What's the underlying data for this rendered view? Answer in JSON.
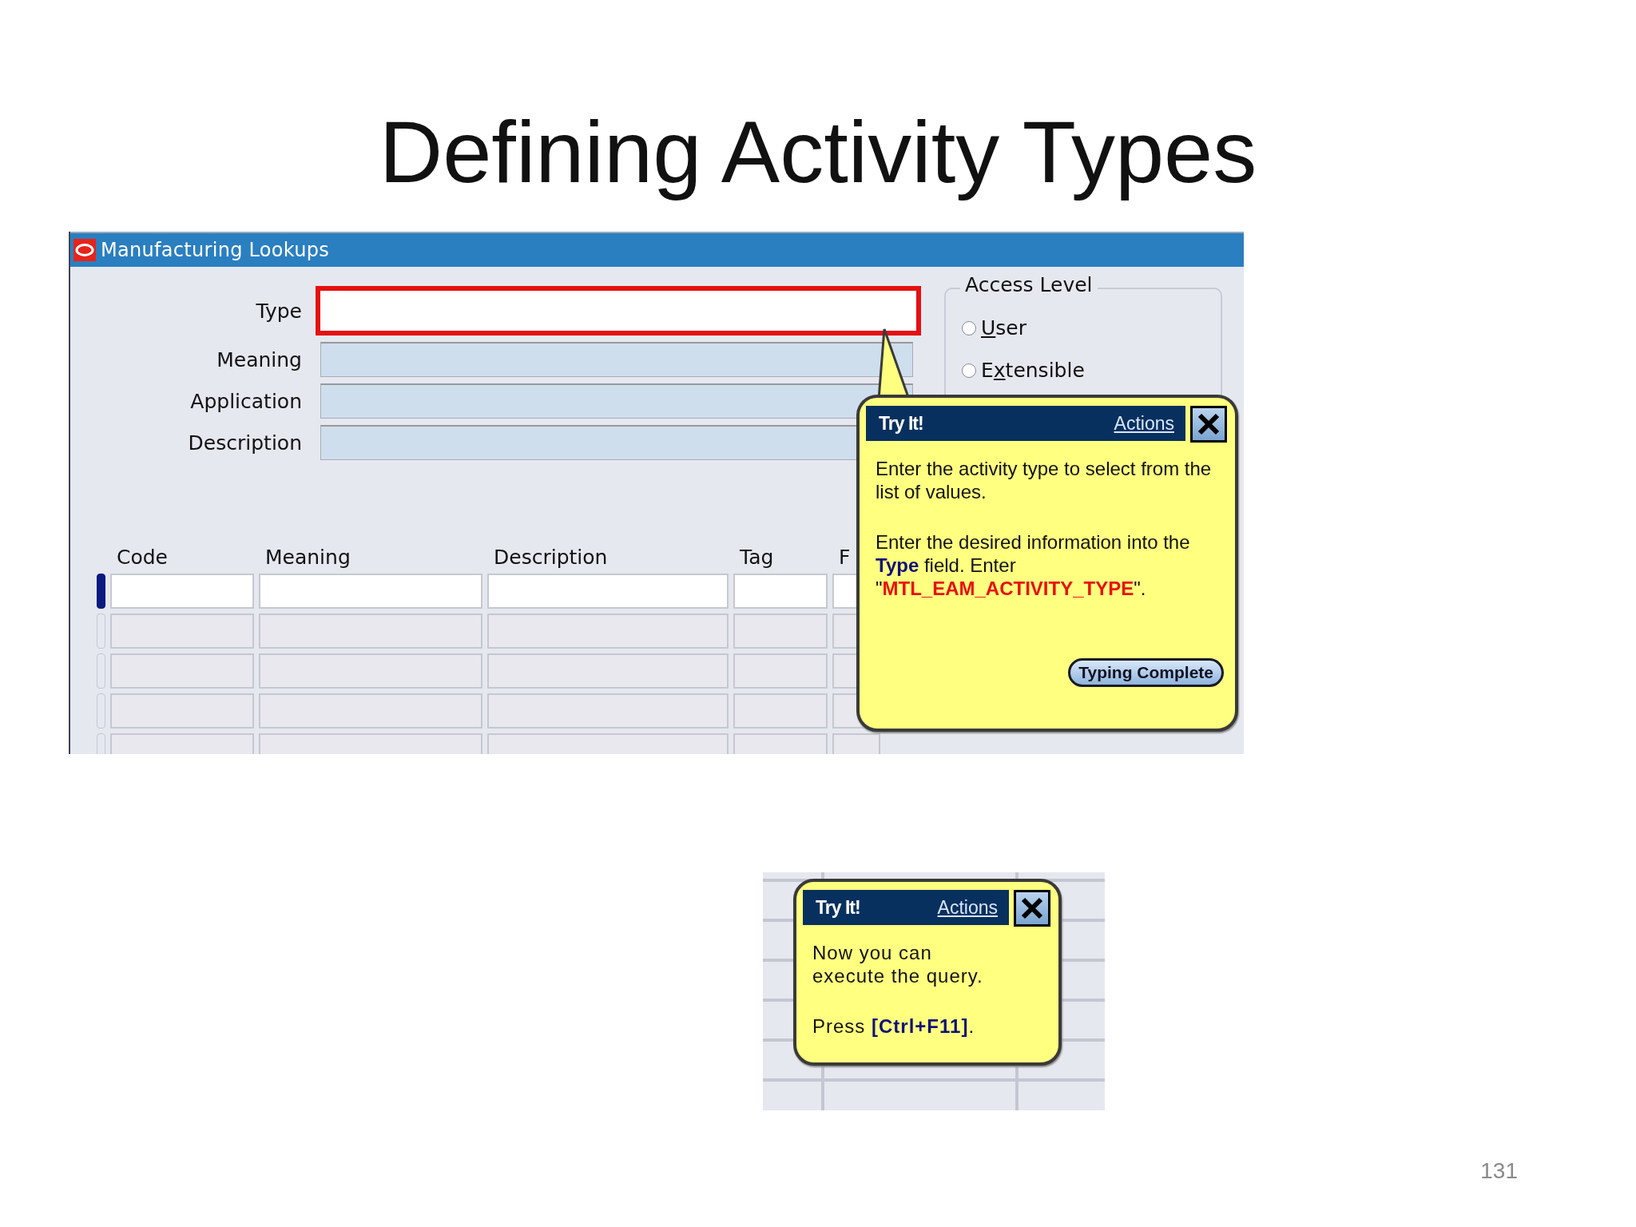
{
  "slide": {
    "title": "Defining Activity Types",
    "page_number": "131"
  },
  "lookup_window": {
    "title": "Manufacturing Lookups",
    "fields": [
      {
        "label": "Type",
        "highlighted": true
      },
      {
        "label": "Meaning",
        "highlighted": false
      },
      {
        "label": "Application",
        "highlighted": false
      },
      {
        "label": "Description",
        "highlighted": false
      }
    ],
    "access_level": {
      "label": "Access Level",
      "options": [
        {
          "access_key": "U",
          "label_rest": "ser",
          "selected": false
        },
        {
          "label_start": "E",
          "access_key": "x",
          "label_rest": "tensible",
          "selected": false
        }
      ]
    },
    "table": {
      "columns": [
        "Code",
        "Meaning",
        "Description",
        "Tag",
        "F"
      ],
      "rows": [
        {
          "current": true
        },
        {
          "current": false
        },
        {
          "current": false
        },
        {
          "current": false
        },
        {
          "current": false
        }
      ]
    }
  },
  "popups": [
    {
      "title": "Try It!",
      "actions": "Actions",
      "paragraphs": [
        [
          {
            "kind": "plain",
            "text": "Enter the activity type to select from the list of values."
          }
        ],
        [
          {
            "kind": "plain",
            "text": "Enter the desired information into the "
          },
          {
            "kind": "field",
            "text": "Type"
          },
          {
            "kind": "plain",
            "text": " field. Enter \""
          },
          {
            "kind": "value",
            "text": "MTL_EAM_ACTIVITY_TYPE"
          },
          {
            "kind": "plain",
            "text": "\"."
          }
        ]
      ],
      "button": "Typing Complete"
    },
    {
      "title": "Try It!",
      "actions": "Actions",
      "paragraphs": [
        [
          {
            "kind": "plain",
            "text": "Now you can execute the query."
          }
        ],
        [
          {
            "kind": "plain",
            "text": "Press "
          },
          {
            "kind": "key",
            "text": "[Ctrl+F11]"
          },
          {
            "kind": "plain",
            "text": "."
          }
        ]
      ]
    }
  ]
}
